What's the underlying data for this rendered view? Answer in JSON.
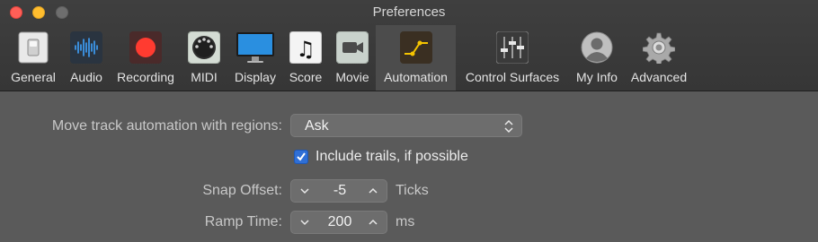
{
  "window": {
    "title": "Preferences"
  },
  "toolbar": {
    "items": [
      {
        "label": "General",
        "icon": "general-switch-icon"
      },
      {
        "label": "Audio",
        "icon": "audio-waveform-icon"
      },
      {
        "label": "Recording",
        "icon": "record-icon"
      },
      {
        "label": "MIDI",
        "icon": "midi-connector-icon"
      },
      {
        "label": "Display",
        "icon": "display-monitor-icon"
      },
      {
        "label": "Score",
        "icon": "music-note-icon"
      },
      {
        "label": "Movie",
        "icon": "movie-camera-icon"
      },
      {
        "label": "Automation",
        "icon": "automation-curve-icon",
        "selected": true
      },
      {
        "label": "Control Surfaces",
        "icon": "control-faders-icon"
      },
      {
        "label": "My Info",
        "icon": "user-avatar-icon"
      },
      {
        "label": "Advanced",
        "icon": "gear-icon"
      }
    ]
  },
  "automation": {
    "move_track_label": "Move track automation with regions:",
    "move_track_value": "Ask",
    "include_trails_label": "Include trails, if possible",
    "include_trails_checked": true,
    "snap_offset_label": "Snap Offset:",
    "snap_offset_value": "-5",
    "snap_offset_unit": "Ticks",
    "ramp_time_label": "Ramp Time:",
    "ramp_time_value": "200",
    "ramp_time_unit": "ms"
  },
  "colors": {
    "accent": "#2f6fd6",
    "record": "#ff3b30",
    "automation_curve": "#f5c400"
  }
}
